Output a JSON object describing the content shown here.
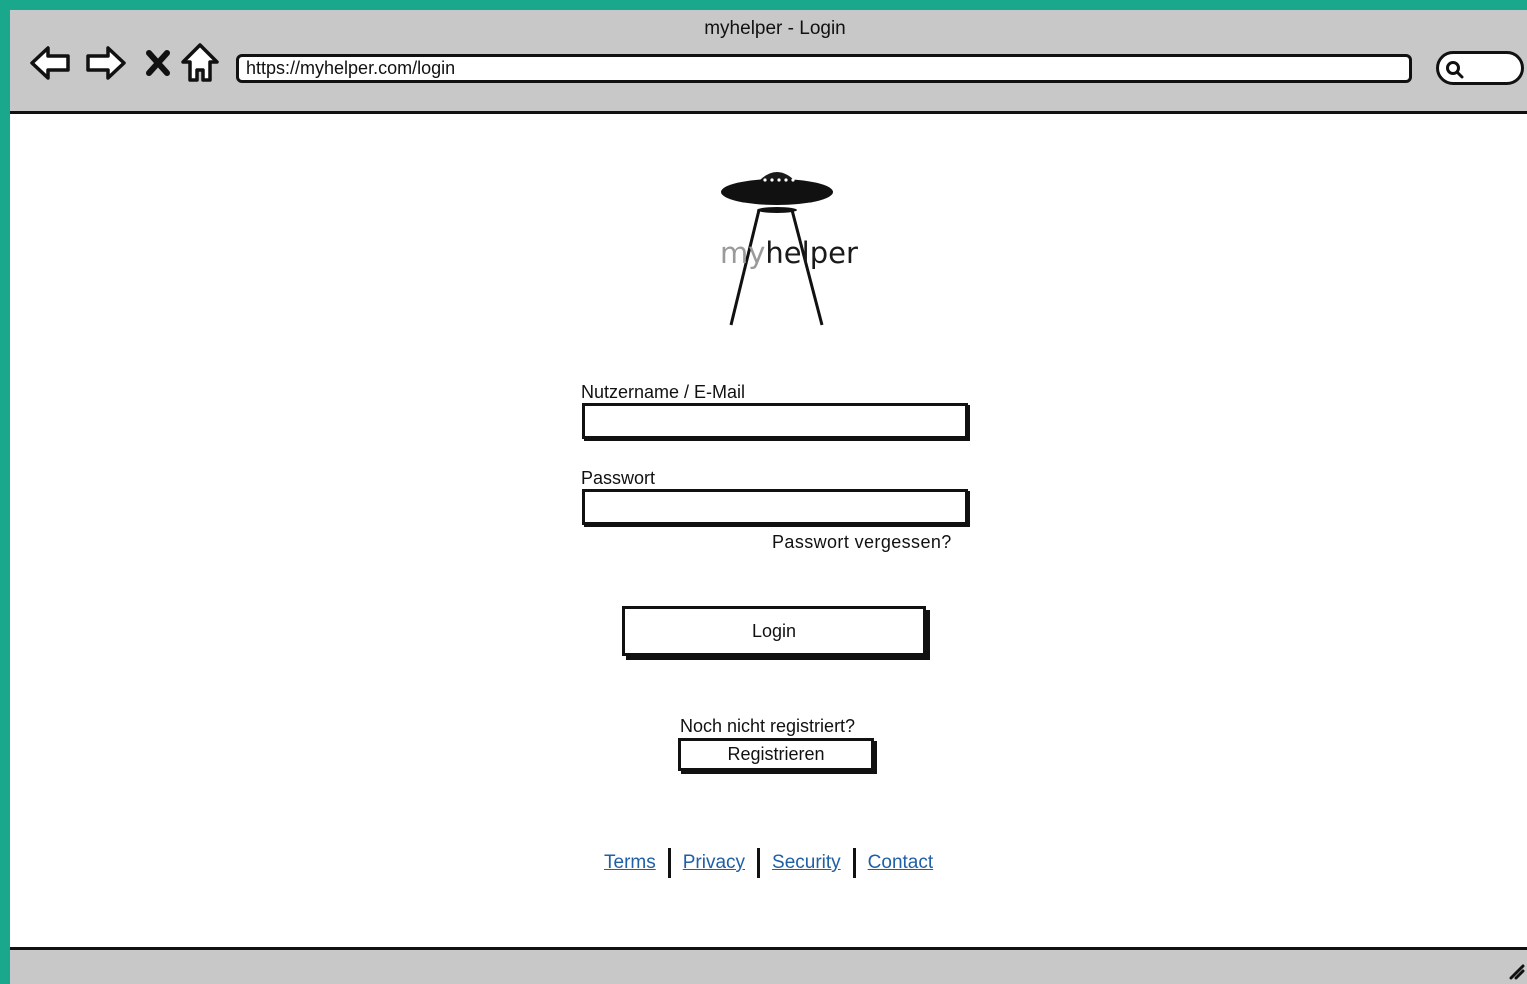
{
  "window": {
    "title": "myhelper - Login"
  },
  "browser": {
    "url": "https://myhelper.com/login",
    "nav_icons": [
      "back-arrow-icon",
      "forward-arrow-icon",
      "close-x-icon",
      "home-icon"
    ],
    "search_icon": "search-icon"
  },
  "logo": {
    "icon": "ufo-icon",
    "text_part1": "my",
    "text_part2": "helper"
  },
  "form": {
    "username_label": "Nutzername / E-Mail",
    "username_value": "",
    "password_label": "Passwort",
    "password_value": "",
    "forgot_link": "Passwort vergessen?",
    "login_button": "Login",
    "not_registered_text": "Noch nicht registriert?",
    "register_button": "Registrieren"
  },
  "footer": {
    "links": [
      "Terms",
      "Privacy",
      "Security",
      "Contact"
    ]
  },
  "colors": {
    "background": "#1aa88c",
    "chrome": "#c8c8c8",
    "link": "#1f5fa6"
  }
}
